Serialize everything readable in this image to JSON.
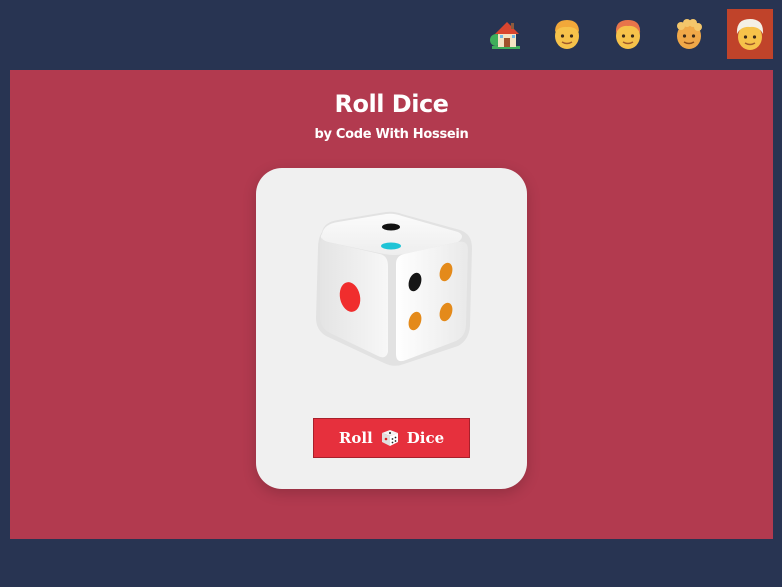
{
  "nav": {
    "items": [
      {
        "name": "home-icon",
        "active": false
      },
      {
        "name": "person-blond-icon",
        "active": false
      },
      {
        "name": "person-red-hair-icon",
        "active": false
      },
      {
        "name": "person-curly-hair-icon",
        "active": false
      },
      {
        "name": "person-white-hair-icon",
        "active": true
      }
    ],
    "active_color": "#c0432a"
  },
  "main": {
    "title": "Roll Dice",
    "subtitle": "by Code With Hossein",
    "dice_icon": "dice-icon",
    "button": {
      "label_left": "Roll",
      "icon": "game-die-icon",
      "label_right": "Dice"
    }
  },
  "colors": {
    "background": "#283452",
    "panel": "#b23a4f",
    "card": "#f0f0f0",
    "button": "#e6303d"
  }
}
